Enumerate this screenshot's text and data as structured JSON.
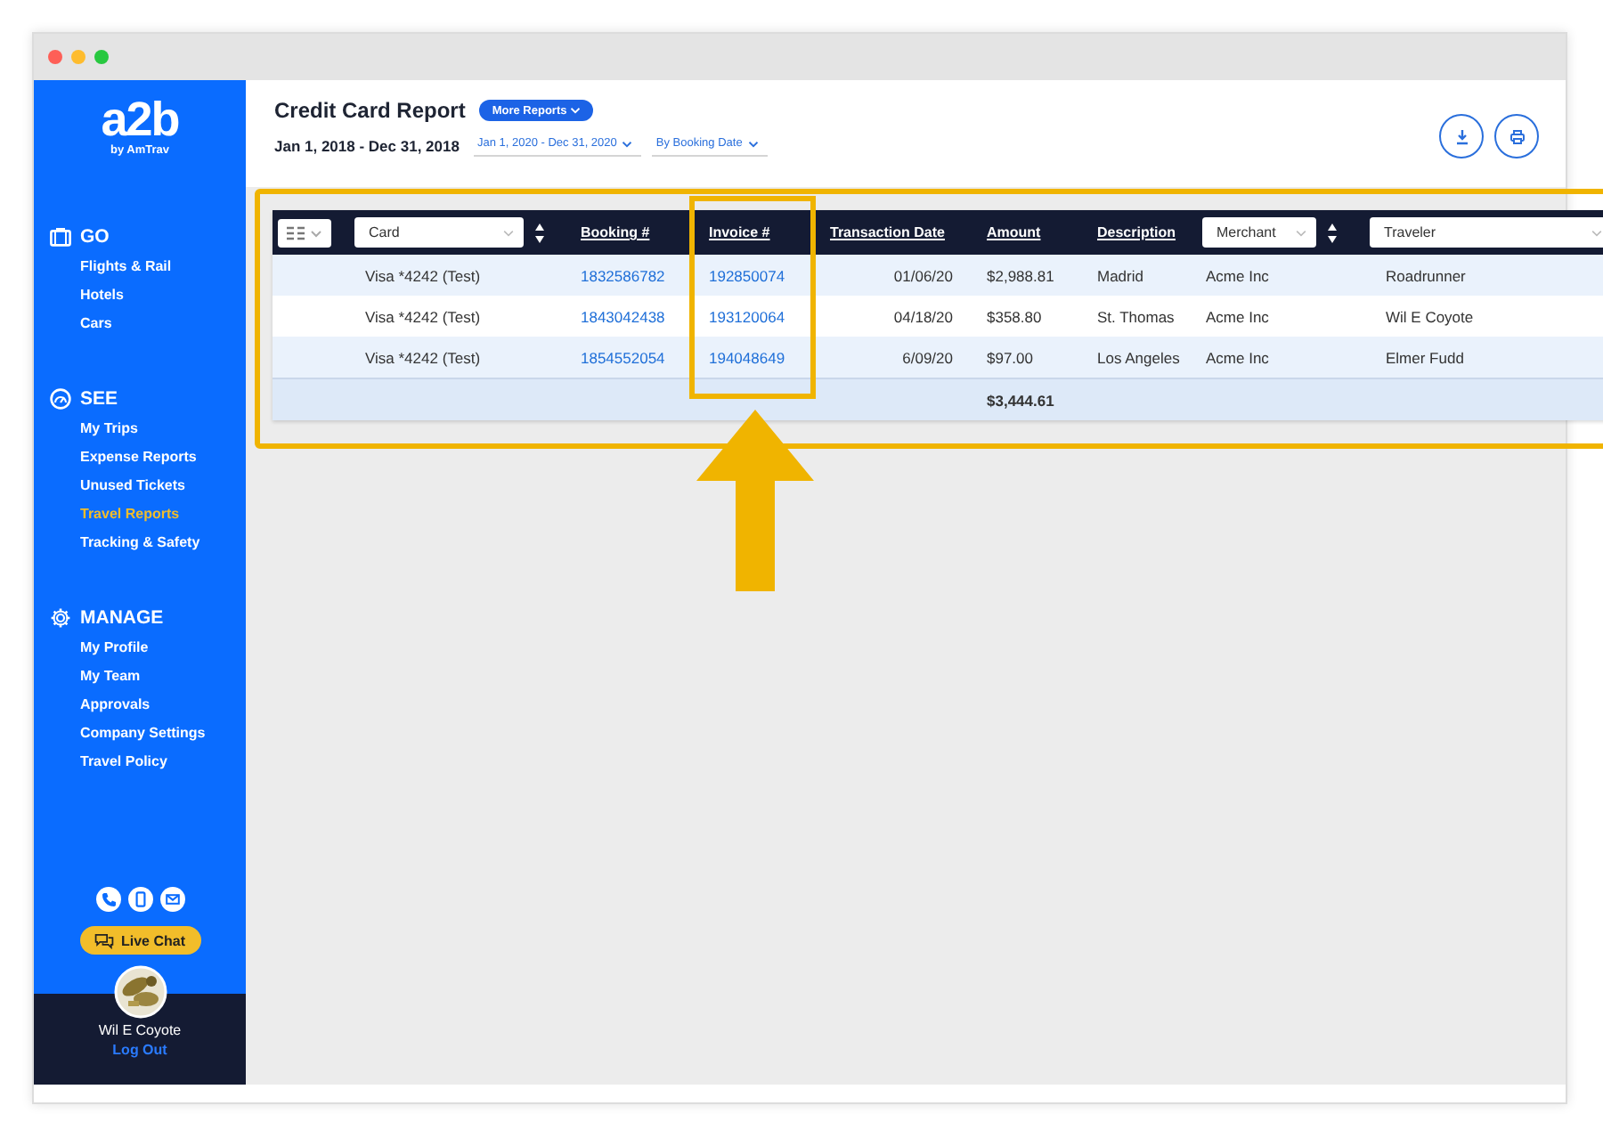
{
  "sidebar": {
    "logo": "a2b",
    "logo_sub": "by AmTrav",
    "sections": [
      {
        "title": "GO",
        "items": [
          {
            "label": "Flights & Rail",
            "selected": false
          },
          {
            "label": "Hotels",
            "selected": false
          },
          {
            "label": "Cars",
            "selected": false
          }
        ]
      },
      {
        "title": "SEE",
        "items": [
          {
            "label": "My Trips",
            "selected": false
          },
          {
            "label": "Expense Reports",
            "selected": false
          },
          {
            "label": "Unused Tickets",
            "selected": false
          },
          {
            "label": "Travel Reports",
            "selected": true
          },
          {
            "label": "Tracking & Safety",
            "selected": false
          }
        ]
      },
      {
        "title": "MANAGE",
        "items": [
          {
            "label": "My Profile",
            "selected": false
          },
          {
            "label": "My Team",
            "selected": false
          },
          {
            "label": "Approvals",
            "selected": false
          },
          {
            "label": "Company Settings",
            "selected": false
          },
          {
            "label": "Travel Policy",
            "selected": false
          }
        ]
      }
    ],
    "live_chat": "Live Chat",
    "user": {
      "name": "Wil E Coyote",
      "logout": "Log Out"
    }
  },
  "report": {
    "title": "Credit Card Report",
    "more_reports": "More Reports",
    "date_range": "Jan 1, 2018 - Dec 31, 2018",
    "filters": [
      "Jan 1, 2020 - Dec 31, 2020",
      "By Booking Date"
    ]
  },
  "table": {
    "columns": [
      {
        "label": "Card",
        "kind": "dropdown",
        "sortable": true
      },
      {
        "label": "Booking #",
        "kind": "link",
        "sortable": false
      },
      {
        "label": "Invoice #",
        "kind": "link",
        "sortable": false
      },
      {
        "label": "Transaction Date",
        "kind": "link",
        "sortable": false
      },
      {
        "label": "Amount",
        "kind": "link",
        "sortable": false
      },
      {
        "label": "Description",
        "kind": "link",
        "sortable": false
      },
      {
        "label": "Merchant",
        "kind": "dropdown",
        "sortable": true
      },
      {
        "label": "Traveler",
        "kind": "dropdown",
        "sortable": false
      }
    ],
    "rows": [
      [
        "Visa *4242 (Test)",
        "1832586782",
        "192850074",
        "01/06/20",
        "$2,988.81",
        "Madrid",
        "Acme Inc",
        "Roadrunner"
      ],
      [
        "Visa *4242 (Test)",
        "1843042438",
        "193120064",
        "04/18/20",
        "$358.80",
        "St. Thomas",
        "Acme Inc",
        "Wil E Coyote"
      ],
      [
        "Visa *4242 (Test)",
        "1854552054",
        "194048649",
        "6/09/20",
        "$97.00",
        "Los Angeles",
        "Acme Inc",
        "Elmer Fudd"
      ]
    ],
    "total": {
      "amount": "$3,444.61"
    }
  }
}
